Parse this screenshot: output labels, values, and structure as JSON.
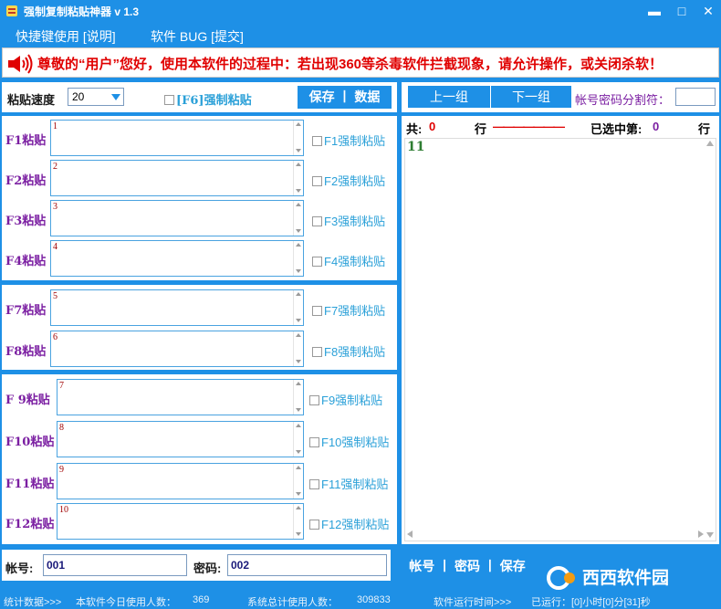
{
  "window": {
    "title": "强制复制粘贴神器 v 1.3",
    "minimize": "▬",
    "maximize": "□",
    "close": "✕"
  },
  "menu": {
    "item1": "快捷键使用 [说明]",
    "item2": "软件 BUG  [提交]"
  },
  "notice": "尊敬的“用户”您好，使用本软件的过程中：若出现360等杀毒软件拦截现象，请允许操作，或关闭杀软！",
  "speed": {
    "label": "粘贴速度",
    "value": "20"
  },
  "f6": {
    "label": "[F6]强制粘贴"
  },
  "buttons": {
    "save_data": "保存 丨 数据",
    "prev_group": "上一组",
    "next_group": "下一组",
    "account_actions": "帐号 丨 密码 丨 保存"
  },
  "separator_label": "帐号密码分割符：",
  "group1": [
    {
      "label": "F1粘贴",
      "num": "1",
      "check": "F1强制粘贴"
    },
    {
      "label": "F2粘贴",
      "num": "2",
      "check": "F2强制粘贴"
    },
    {
      "label": "F3粘贴",
      "num": "3",
      "check": "F3强制粘贴"
    },
    {
      "label": "F4粘贴",
      "num": "4",
      "check": "F4强制粘贴"
    }
  ],
  "group2": [
    {
      "label": "F7粘贴",
      "num": "5",
      "check": "F7强制粘贴"
    },
    {
      "label": "F8粘贴",
      "num": "6",
      "check": "F8强制粘贴"
    }
  ],
  "group3": [
    {
      "label": "F 9粘贴",
      "num": "7",
      "check": "F9强制粘贴"
    },
    {
      "label": "F10粘贴",
      "num": "8",
      "check": "F10强制粘贴"
    },
    {
      "label": "F11粘贴",
      "num": "9",
      "check": "F11强制粘贴"
    },
    {
      "label": "F12粘贴",
      "num": "10",
      "check": "F12强制粘贴"
    }
  ],
  "right": {
    "total_label": "共:",
    "total_value": "0",
    "row_label": "行",
    "dashes": "———————",
    "selected_label": "已选中第:",
    "selected_value": "0",
    "row_label2": "行",
    "list_first": "11"
  },
  "account": {
    "account_label": "帐号:",
    "account_value": "001",
    "password_label": "密码:",
    "password_value": "002"
  },
  "status": {
    "s1": "统计数据>>>",
    "s2": "本软件今日使用人数：",
    "s3": "369",
    "s4": "系统总计使用人数：",
    "s5": "309833",
    "s6": "软件运行时间>>>",
    "s7": "已运行：[0]小时[0]分[31]秒"
  },
  "watermark": "西西软件园",
  "colors": {
    "accent": "#1e90e6",
    "label_purple": "#7b1fa2",
    "notice_red": "#e00000",
    "check_teal": "#2aa0d8"
  }
}
